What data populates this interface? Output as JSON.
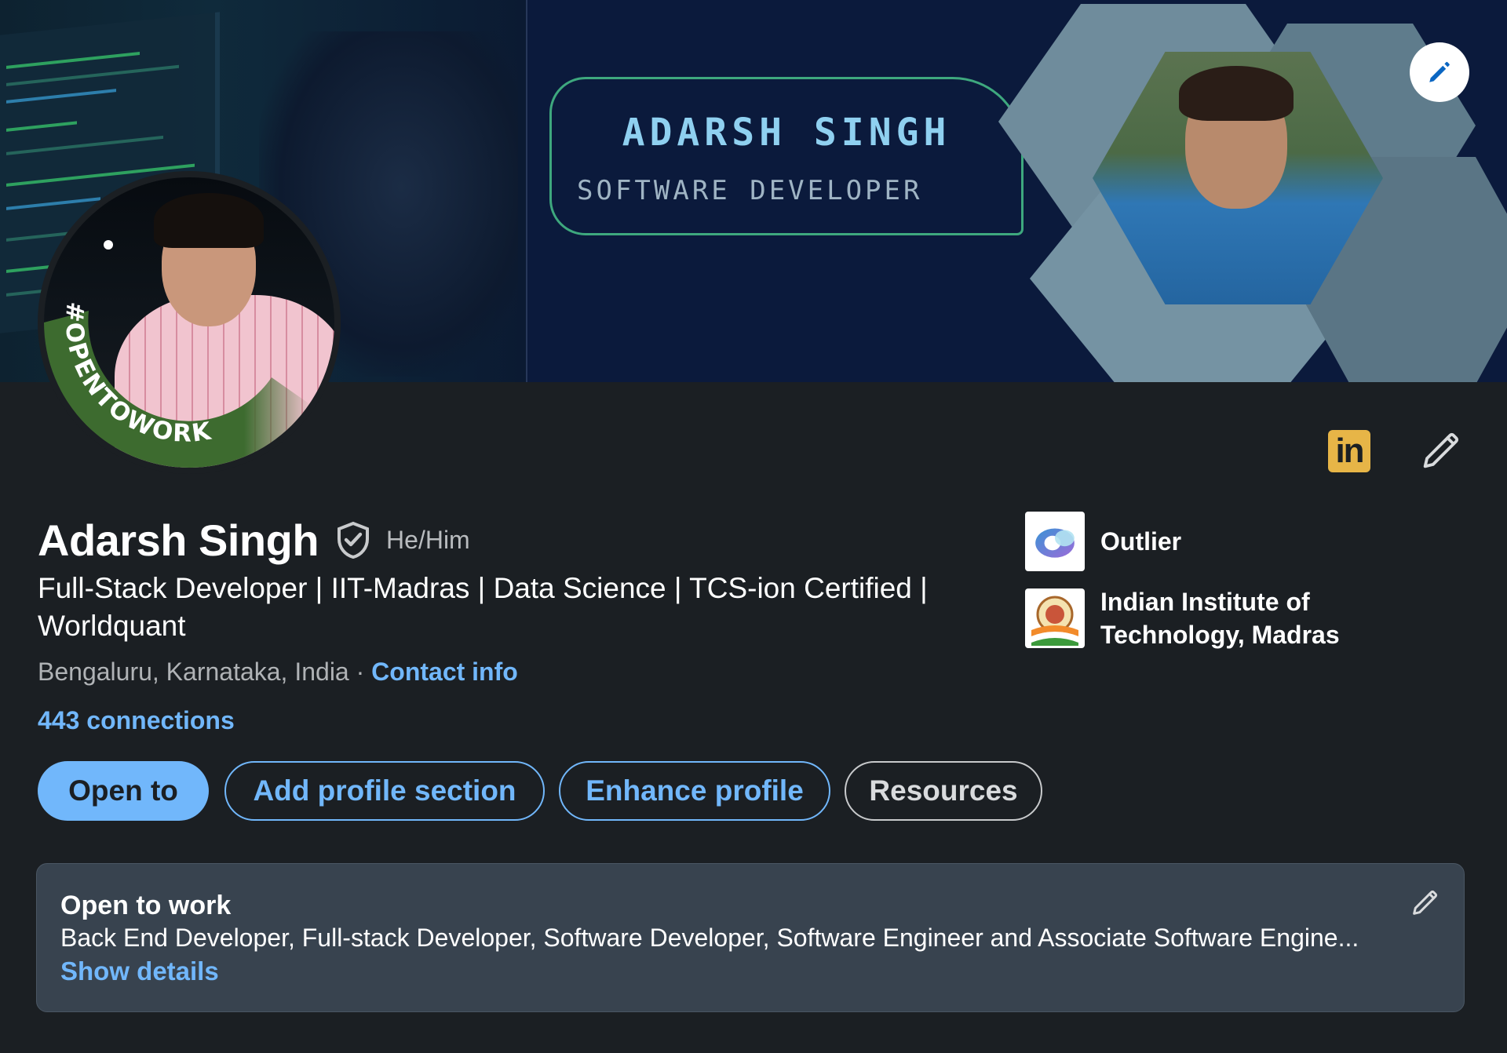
{
  "banner": {
    "name": "ADARSH SINGH",
    "role": "SOFTWARE DEVELOPER"
  },
  "avatar": {
    "badge_text": "#OPENTOWORK"
  },
  "profile": {
    "name": "Adarsh Singh",
    "pronouns": "He/Him",
    "headline": "Full-Stack Developer | IIT-Madras | Data Science | TCS-ion Certified | Worldquant",
    "location": "Bengaluru, Karnataka, India",
    "separator": " · ",
    "contact_label": "Contact info",
    "connections": "443 connections"
  },
  "orgs": [
    {
      "name": "Outlier",
      "icon": "outlier-logo"
    },
    {
      "name": "Indian Institute of Technology, Madras",
      "icon": "iit-madras-logo"
    }
  ],
  "actions": {
    "open_to": "Open to",
    "add_section": "Add profile section",
    "enhance": "Enhance profile",
    "resources": "Resources"
  },
  "open_to_work": {
    "title": "Open to work",
    "roles": "Back End Developer, Full-stack Developer, Software Developer, Software Engineer and Associate Software Engine...",
    "details_label": "Show details"
  },
  "icons": {
    "linkedin_badge": "in",
    "edit_cover": "pencil-icon",
    "edit_intro": "pencil-icon",
    "verified": "shield-check-icon"
  },
  "colors": {
    "accent": "#71b7fb",
    "background": "#1b1f23",
    "card": "#38434f",
    "opentowork_green": "#3d6b2f",
    "linkedin_badge": "#e7b547"
  }
}
